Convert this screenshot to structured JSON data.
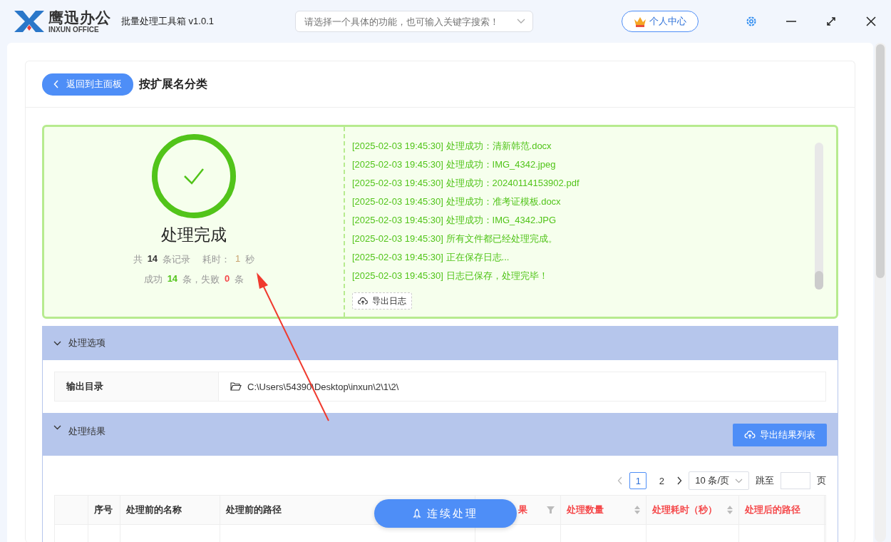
{
  "app": {
    "logo_cn": "鹰迅办公",
    "logo_en": "INXUN OFFICE",
    "title": "批量处理工具箱 v1.0.1",
    "search_placeholder": "请选择一个具体的功能，也可输入关键字搜索！",
    "user_button": "个人中心"
  },
  "page": {
    "back_button": "返回到主面板",
    "title": "按扩展名分类"
  },
  "result": {
    "status": "处理完成",
    "total_prefix": "共",
    "total": "14",
    "total_suffix": "条记录",
    "time_label": "耗时：",
    "time": "1",
    "time_unit": "秒",
    "success_label": "成功",
    "success": "14",
    "success_unit": "条，失败",
    "failed": "0",
    "failed_unit": "条"
  },
  "log": {
    "lines": [
      "[2025-02-03 19:45:30] 处理成功：清新韩范.docx",
      "[2025-02-03 19:45:30] 处理成功：IMG_4342.jpeg",
      "[2025-02-03 19:45:30] 处理成功：20240114153902.pdf",
      "[2025-02-03 19:45:30] 处理成功：准考证模板.docx",
      "[2025-02-03 19:45:30] 处理成功：IMG_4342.JPG",
      "[2025-02-03 19:45:30] 所有文件都已经处理完成。",
      "[2025-02-03 19:45:30] 正在保存日志...",
      "[2025-02-03 19:45:30] 日志已保存，处理完毕！"
    ],
    "export_button": "导出日志"
  },
  "options": {
    "title": "处理选项",
    "expanded": true,
    "rows": [
      {
        "label": "输出目录",
        "value": "C:\\Users\\54390\\Desktop\\inxun\\2\\1\\2\\"
      }
    ]
  },
  "results": {
    "title": "处理结果",
    "expanded": true,
    "export_button": "导出结果列表",
    "pagination": {
      "pages": [
        {
          "label": "1",
          "selected": true
        },
        {
          "label": "2",
          "selected": false
        }
      ],
      "page_size": "10 条/页",
      "jump_label": "跳至",
      "page_unit": "页"
    },
    "columns": [
      {
        "highlight": false,
        "kind": "plain"
      },
      {
        "label": "序号",
        "highlight": false,
        "kind": "plain"
      },
      {
        "label": "处理前的名称",
        "highlight": false,
        "kind": "plain"
      },
      {
        "label": "处理前的路径",
        "highlight": false,
        "kind": "plain"
      },
      {
        "label": "果",
        "highlight": true,
        "kind": "filter"
      },
      {
        "label": "处理数量",
        "highlight": true,
        "kind": "sort"
      },
      {
        "label": "处理耗时（秒）",
        "highlight": true,
        "kind": "sort"
      },
      {
        "label": "处理后的路径",
        "highlight": true,
        "kind": "plain"
      }
    ]
  },
  "float_button": "连续处理"
}
